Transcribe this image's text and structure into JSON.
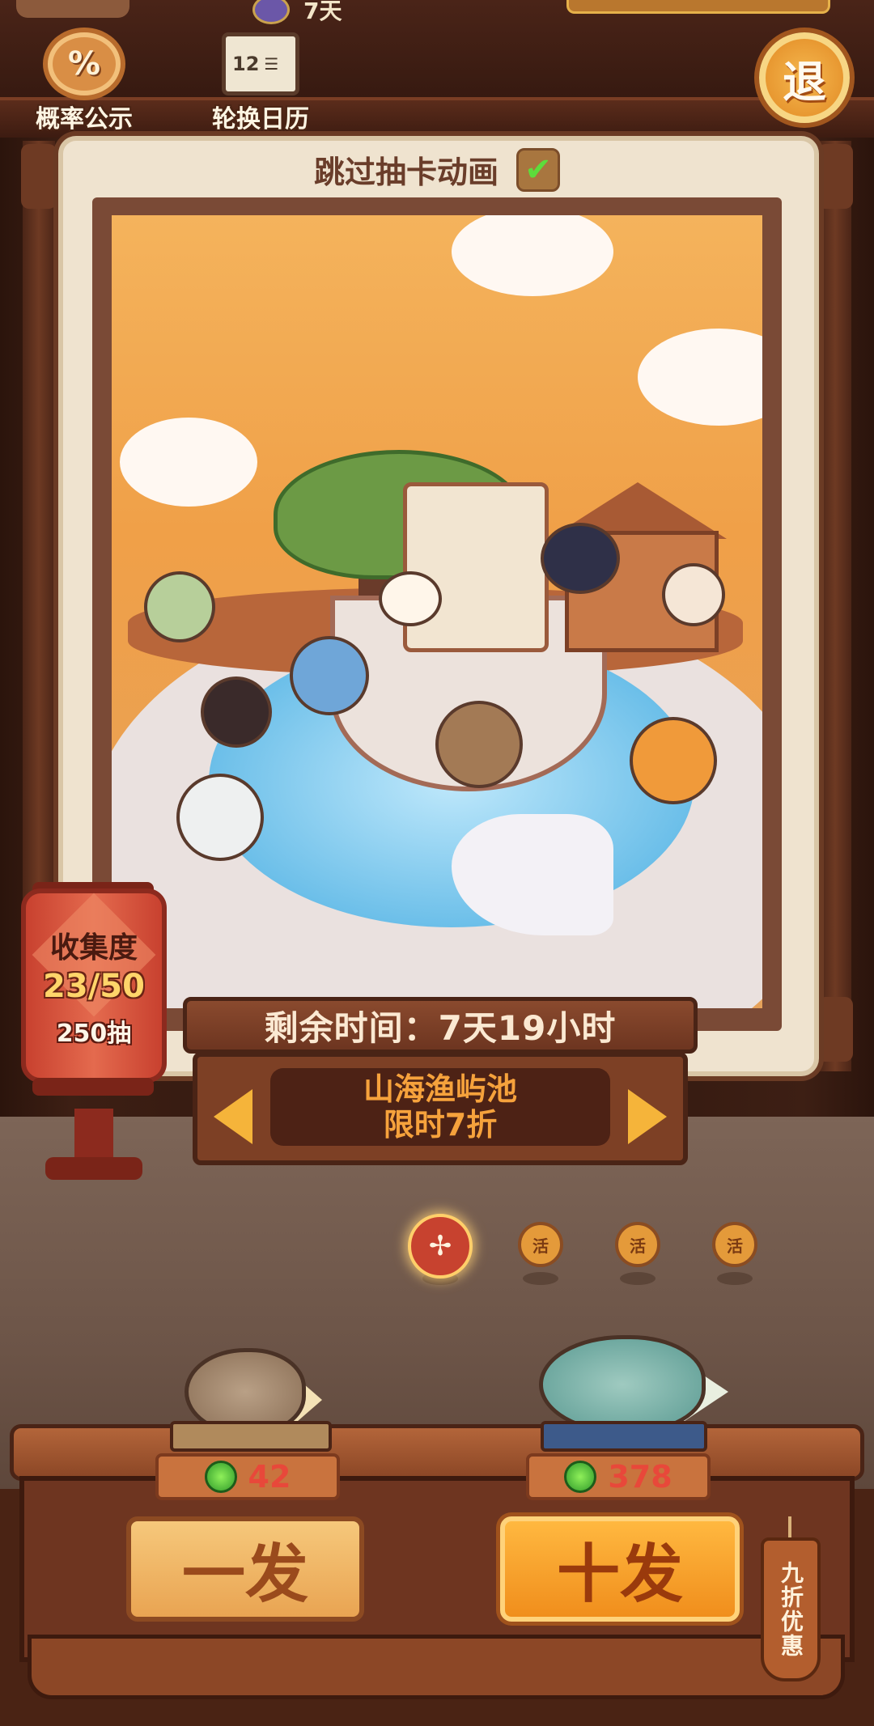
{
  "header": {
    "days_label": "7天",
    "probability_label": "概率公示",
    "probability_icon": "%",
    "calendar_label": "轮换日历",
    "calendar_icon_text": "12",
    "exit_label": "退"
  },
  "card": {
    "skip_animation_label": "跳过抽卡动画",
    "skip_animation_checked": "✔"
  },
  "collection": {
    "title": "收集度",
    "progress": "23/50",
    "pulls": "250抽"
  },
  "pool": {
    "time_remaining": "剩余时间：7天19小时",
    "name": "山海渔屿池",
    "discount": "限时7折"
  },
  "pager": {
    "active_icon": "✢",
    "inactive_icon": "活",
    "total": 4,
    "active_index": 0
  },
  "pulls": {
    "single": {
      "label": "一发",
      "cost": "42"
    },
    "ten": {
      "label": "十发",
      "cost": "378"
    },
    "ten_tag": "九折优惠"
  },
  "colors": {
    "accent_orange": "#f5b43a",
    "cost_red": "#e8483a",
    "coin_green": "#2f9a2a",
    "lantern_red": "#c8412f"
  }
}
